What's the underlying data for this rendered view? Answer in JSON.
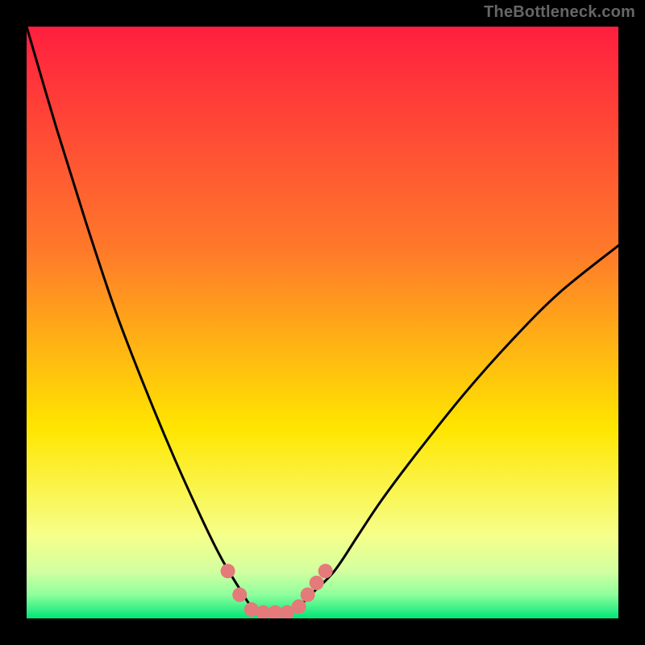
{
  "watermark": "TheBottleneck.com",
  "colors": {
    "background": "#000000",
    "gradient_top": "#ff1f3f",
    "gradient_mid_upper": "#ff7a2a",
    "gradient_mid": "#ffe600",
    "gradient_low1": "#f6ff8a",
    "gradient_low2": "#d3ffa0",
    "gradient_low3": "#8fff9e",
    "gradient_bottom": "#00e676",
    "curve": "#000000",
    "marker": "#e47a7a"
  },
  "chart_data": {
    "type": "line",
    "title": "",
    "xlabel": "",
    "ylabel": "",
    "xlim": [
      0,
      100
    ],
    "ylim": [
      0,
      100
    ],
    "series": [
      {
        "name": "bottleneck-curve",
        "x": [
          0,
          5,
          10,
          15,
          20,
          25,
          30,
          33,
          36,
          38,
          40,
          42,
          44,
          46,
          48,
          52,
          56,
          60,
          66,
          74,
          82,
          90,
          100
        ],
        "y": [
          100,
          83,
          67,
          52,
          39,
          27,
          16,
          10,
          5,
          2,
          1,
          1,
          1,
          2,
          4,
          8,
          14,
          20,
          28,
          38,
          47,
          55,
          63
        ]
      }
    ],
    "markers": [
      {
        "name": "left-shoulder-top",
        "x": 34.0,
        "y": 8.0
      },
      {
        "name": "left-shoulder-bottom",
        "x": 36.0,
        "y": 4.0
      },
      {
        "name": "trough-left",
        "x": 38.0,
        "y": 1.5
      },
      {
        "name": "trough-1",
        "x": 40.0,
        "y": 1.0
      },
      {
        "name": "trough-2",
        "x": 42.0,
        "y": 1.0
      },
      {
        "name": "trough-3",
        "x": 44.0,
        "y": 1.0
      },
      {
        "name": "trough-right",
        "x": 46.0,
        "y": 2.0
      },
      {
        "name": "right-shoulder-1",
        "x": 47.5,
        "y": 4.0
      },
      {
        "name": "right-shoulder-2",
        "x": 49.0,
        "y": 6.0
      },
      {
        "name": "right-shoulder-3",
        "x": 50.5,
        "y": 8.0
      }
    ]
  }
}
